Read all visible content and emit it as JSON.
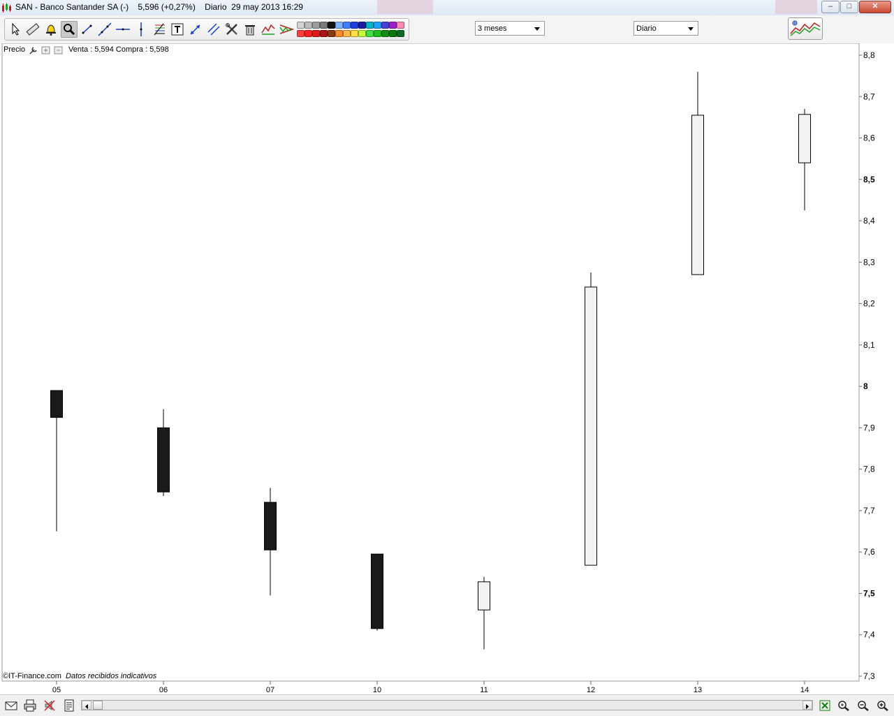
{
  "window": {
    "title_symbol": "SAN - Banco Santander SA (-)",
    "title_price": "5,596 (+0,27%)",
    "title_period": "Diario",
    "title_datetime": "29 may 2013 16:29",
    "buttons": {
      "minimize": "–",
      "maximize": "□",
      "close": "✕"
    }
  },
  "toolbar": {
    "tools": [
      "pointer-icon",
      "ruler-icon",
      "alarm-bell-icon",
      "zoom-magnifier-icon",
      "trendline-icon",
      "extended-line-icon",
      "horizontal-line-icon",
      "vertical-line-icon",
      "fibonacci-icon",
      "text-tool-icon",
      "arrow-line-icon",
      "parallel-lines-icon",
      "tools-icon",
      "trash-icon",
      "zigzag-indicator-icon",
      "triangle-pattern-icon"
    ],
    "active_tool": "zoom-magnifier-icon",
    "color_palette_top": [
      "#d4d4d4",
      "#bdbdbd",
      "#9e9e9e",
      "#7a7a7a",
      "#111111",
      "#7fb2ff",
      "#3f7fff",
      "#1f3fe0",
      "#1c1c9e",
      "#00b4c8",
      "#1fa0ff",
      "#4a3fd8",
      "#a020c8",
      "#ff8ab8"
    ],
    "color_palette_bottom": [
      "#ff4040",
      "#ff2020",
      "#e01818",
      "#b01010",
      "#8a3a10",
      "#ff8a2a",
      "#ffb84a",
      "#ffe040",
      "#c8ff40",
      "#40e040",
      "#20c020",
      "#109010",
      "#0a7a0a",
      "#0a6a2a"
    ],
    "range_select": {
      "value": "3 meses"
    },
    "interval_select": {
      "value": "Diario"
    }
  },
  "chart_panel": {
    "legend_label": "Precio",
    "quote": "Venta : 5,594 Compra : 5,598",
    "copyright": "©IT-Finance.com",
    "data_note": "Datos recibidos indicativos"
  },
  "chart_data": {
    "type": "candlestick",
    "y_axis_position": "right",
    "ylim": [
      7.3,
      8.8
    ],
    "y_ticks": [
      "8,8",
      "8,7",
      "8,6",
      "8,5",
      "8,4",
      "8,3",
      "8,2",
      "8,1",
      "8",
      "7,9",
      "7,8",
      "7,7",
      "7,6",
      "7,5",
      "7,4",
      "7,3"
    ],
    "y_tick_values": [
      8.8,
      8.7,
      8.6,
      8.5,
      8.4,
      8.3,
      8.2,
      8.1,
      8.0,
      7.9,
      7.8,
      7.7,
      7.6,
      7.5,
      7.4,
      7.3
    ],
    "y_bold_ticks": [
      "8,5",
      "8",
      "7,5"
    ],
    "x_labels": [
      "05",
      "06",
      "07",
      "10",
      "11",
      "12",
      "13",
      "14"
    ],
    "candles": [
      {
        "date": "05",
        "open": 7.99,
        "high": 7.99,
        "low": 7.65,
        "close": 7.925
      },
      {
        "date": "06",
        "open": 7.9,
        "high": 7.945,
        "low": 7.735,
        "close": 7.745
      },
      {
        "date": "07",
        "open": 7.72,
        "high": 7.755,
        "low": 7.495,
        "close": 7.605
      },
      {
        "date": "10",
        "open": 7.595,
        "high": 7.595,
        "low": 7.41,
        "close": 7.415
      },
      {
        "date": "11",
        "open": 7.46,
        "high": 7.54,
        "low": 7.365,
        "close": 7.528
      },
      {
        "date": "12",
        "open": 7.568,
        "high": 8.275,
        "low": 7.568,
        "close": 8.24
      },
      {
        "date": "13",
        "open": 8.27,
        "high": 8.76,
        "low": 8.27,
        "close": 8.655
      },
      {
        "date": "14",
        "open": 8.54,
        "high": 8.67,
        "low": 8.425,
        "close": 8.657
      }
    ],
    "colors": {
      "up_fill": "#f2f2f2",
      "down_fill": "#1a1a1a",
      "outline": "#000000"
    }
  },
  "bottombar": {
    "icons": [
      "email-icon",
      "print-icon",
      "no-sound-icon",
      "report-icon"
    ],
    "right_icons": [
      "excel-export-icon",
      "zoom-fit-icon",
      "zoom-out-icon",
      "zoom-in-icon"
    ]
  }
}
